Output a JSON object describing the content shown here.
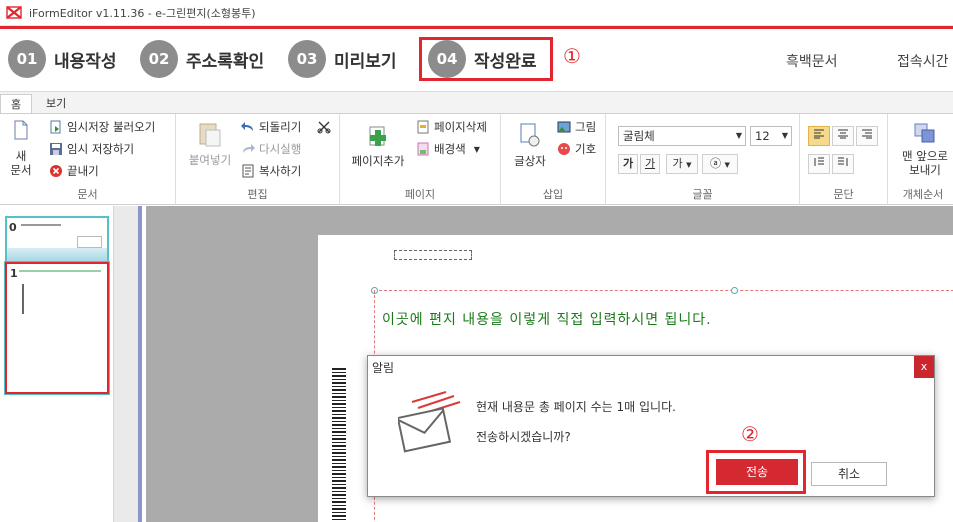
{
  "window": {
    "title": "iFormEditor v1.11.36 - e-그린편지(소형봉투)"
  },
  "steps": [
    {
      "num": "01",
      "label": "내용작성"
    },
    {
      "num": "02",
      "label": "주소록확인"
    },
    {
      "num": "03",
      "label": "미리보기"
    },
    {
      "num": "04",
      "label": "작성완료"
    }
  ],
  "annotations": {
    "one": "①",
    "two": "②"
  },
  "header_links": {
    "bw_doc": "흑백문서",
    "access_time": "접속시간"
  },
  "ribbon_tabs": [
    "홈",
    "보기"
  ],
  "ribbon": {
    "doc": {
      "new": "새\n문서",
      "load_temp": "임시저장 불러오기",
      "save_temp": "임시 저장하기",
      "exit": "끝내기",
      "label": "문서"
    },
    "edit": {
      "paste": "붙여넣기",
      "undo": "되돌리기",
      "redo": "다시실행",
      "copy": "복사하기",
      "label": "편집"
    },
    "page": {
      "add": "페이지추가",
      "delete": "페이지삭제",
      "bg": "배경색",
      "label": "페이지"
    },
    "insert": {
      "textbox": "글상자",
      "image": "그림",
      "symbol": "기호",
      "label": "삽입"
    },
    "font": {
      "family": "굴림체",
      "size": "12",
      "bold": "가",
      "underline": "가",
      "char": "가",
      "more": "ⓐ",
      "label": "글꼴"
    },
    "paragraph": {
      "label": "문단"
    },
    "arrange": {
      "front": "맨 앞으로\n보내기",
      "label": "개체순서"
    }
  },
  "thumbnails": [
    "0",
    "1"
  ],
  "document": {
    "placeholder": "이곳에 편지 내용을 이렇게 직접 입력하시면 됩니다."
  },
  "dialog": {
    "title": "알림",
    "close": "x",
    "message1": "현재 내용문 총 페이지 수는 1매 입니다.",
    "message2": "전송하시겠습니까?",
    "send": "전송",
    "cancel": "취소"
  },
  "colors": {
    "accent": "#e1262d",
    "step_circle": "#8c8c8c",
    "placeholder_text": "#1a7a1a"
  }
}
